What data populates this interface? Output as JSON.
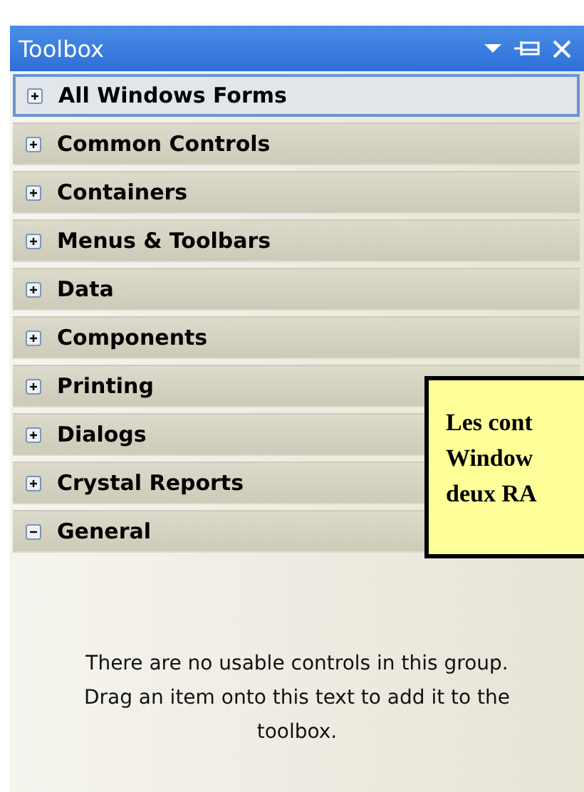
{
  "window": {
    "title": "Toolbox"
  },
  "groups": [
    {
      "label": "All Windows Forms",
      "expanded": false,
      "selected": true
    },
    {
      "label": "Common Controls",
      "expanded": false,
      "selected": false
    },
    {
      "label": "Containers",
      "expanded": false,
      "selected": false
    },
    {
      "label": "Menus & Toolbars",
      "expanded": false,
      "selected": false
    },
    {
      "label": "Data",
      "expanded": false,
      "selected": false
    },
    {
      "label": "Components",
      "expanded": false,
      "selected": false
    },
    {
      "label": "Printing",
      "expanded": false,
      "selected": false
    },
    {
      "label": "Dialogs",
      "expanded": false,
      "selected": false
    },
    {
      "label": "Crystal Reports",
      "expanded": false,
      "selected": false
    },
    {
      "label": "General",
      "expanded": true,
      "selected": false
    }
  ],
  "empty_message": "There are no usable controls in this group. Drag an item onto this text to add it to the toolbox.",
  "callout": {
    "lines": [
      "Les cont",
      "Window",
      "deux RA"
    ]
  }
}
